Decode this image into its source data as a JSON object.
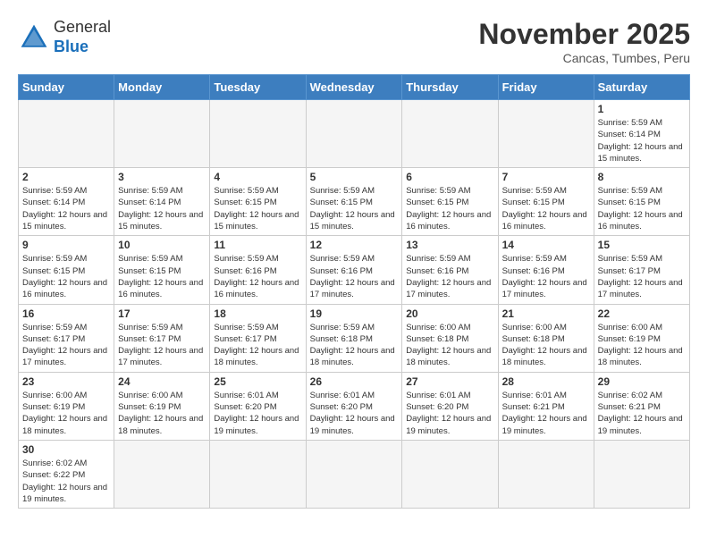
{
  "header": {
    "logo_text_general": "General",
    "logo_text_blue": "Blue",
    "month_year": "November 2025",
    "location": "Cancas, Tumbes, Peru"
  },
  "weekdays": [
    "Sunday",
    "Monday",
    "Tuesday",
    "Wednesday",
    "Thursday",
    "Friday",
    "Saturday"
  ],
  "weeks": [
    [
      {
        "day": "",
        "info": ""
      },
      {
        "day": "",
        "info": ""
      },
      {
        "day": "",
        "info": ""
      },
      {
        "day": "",
        "info": ""
      },
      {
        "day": "",
        "info": ""
      },
      {
        "day": "",
        "info": ""
      },
      {
        "day": "1",
        "info": "Sunrise: 5:59 AM\nSunset: 6:14 PM\nDaylight: 12 hours and 15 minutes."
      }
    ],
    [
      {
        "day": "2",
        "info": "Sunrise: 5:59 AM\nSunset: 6:14 PM\nDaylight: 12 hours and 15 minutes."
      },
      {
        "day": "3",
        "info": "Sunrise: 5:59 AM\nSunset: 6:14 PM\nDaylight: 12 hours and 15 minutes."
      },
      {
        "day": "4",
        "info": "Sunrise: 5:59 AM\nSunset: 6:15 PM\nDaylight: 12 hours and 15 minutes."
      },
      {
        "day": "5",
        "info": "Sunrise: 5:59 AM\nSunset: 6:15 PM\nDaylight: 12 hours and 15 minutes."
      },
      {
        "day": "6",
        "info": "Sunrise: 5:59 AM\nSunset: 6:15 PM\nDaylight: 12 hours and 16 minutes."
      },
      {
        "day": "7",
        "info": "Sunrise: 5:59 AM\nSunset: 6:15 PM\nDaylight: 12 hours and 16 minutes."
      },
      {
        "day": "8",
        "info": "Sunrise: 5:59 AM\nSunset: 6:15 PM\nDaylight: 12 hours and 16 minutes."
      }
    ],
    [
      {
        "day": "9",
        "info": "Sunrise: 5:59 AM\nSunset: 6:15 PM\nDaylight: 12 hours and 16 minutes."
      },
      {
        "day": "10",
        "info": "Sunrise: 5:59 AM\nSunset: 6:15 PM\nDaylight: 12 hours and 16 minutes."
      },
      {
        "day": "11",
        "info": "Sunrise: 5:59 AM\nSunset: 6:16 PM\nDaylight: 12 hours and 16 minutes."
      },
      {
        "day": "12",
        "info": "Sunrise: 5:59 AM\nSunset: 6:16 PM\nDaylight: 12 hours and 17 minutes."
      },
      {
        "day": "13",
        "info": "Sunrise: 5:59 AM\nSunset: 6:16 PM\nDaylight: 12 hours and 17 minutes."
      },
      {
        "day": "14",
        "info": "Sunrise: 5:59 AM\nSunset: 6:16 PM\nDaylight: 12 hours and 17 minutes."
      },
      {
        "day": "15",
        "info": "Sunrise: 5:59 AM\nSunset: 6:17 PM\nDaylight: 12 hours and 17 minutes."
      }
    ],
    [
      {
        "day": "16",
        "info": "Sunrise: 5:59 AM\nSunset: 6:17 PM\nDaylight: 12 hours and 17 minutes."
      },
      {
        "day": "17",
        "info": "Sunrise: 5:59 AM\nSunset: 6:17 PM\nDaylight: 12 hours and 17 minutes."
      },
      {
        "day": "18",
        "info": "Sunrise: 5:59 AM\nSunset: 6:17 PM\nDaylight: 12 hours and 18 minutes."
      },
      {
        "day": "19",
        "info": "Sunrise: 5:59 AM\nSunset: 6:18 PM\nDaylight: 12 hours and 18 minutes."
      },
      {
        "day": "20",
        "info": "Sunrise: 6:00 AM\nSunset: 6:18 PM\nDaylight: 12 hours and 18 minutes."
      },
      {
        "day": "21",
        "info": "Sunrise: 6:00 AM\nSunset: 6:18 PM\nDaylight: 12 hours and 18 minutes."
      },
      {
        "day": "22",
        "info": "Sunrise: 6:00 AM\nSunset: 6:19 PM\nDaylight: 12 hours and 18 minutes."
      }
    ],
    [
      {
        "day": "23",
        "info": "Sunrise: 6:00 AM\nSunset: 6:19 PM\nDaylight: 12 hours and 18 minutes."
      },
      {
        "day": "24",
        "info": "Sunrise: 6:00 AM\nSunset: 6:19 PM\nDaylight: 12 hours and 18 minutes."
      },
      {
        "day": "25",
        "info": "Sunrise: 6:01 AM\nSunset: 6:20 PM\nDaylight: 12 hours and 19 minutes."
      },
      {
        "day": "26",
        "info": "Sunrise: 6:01 AM\nSunset: 6:20 PM\nDaylight: 12 hours and 19 minutes."
      },
      {
        "day": "27",
        "info": "Sunrise: 6:01 AM\nSunset: 6:20 PM\nDaylight: 12 hours and 19 minutes."
      },
      {
        "day": "28",
        "info": "Sunrise: 6:01 AM\nSunset: 6:21 PM\nDaylight: 12 hours and 19 minutes."
      },
      {
        "day": "29",
        "info": "Sunrise: 6:02 AM\nSunset: 6:21 PM\nDaylight: 12 hours and 19 minutes."
      }
    ],
    [
      {
        "day": "30",
        "info": "Sunrise: 6:02 AM\nSunset: 6:22 PM\nDaylight: 12 hours and 19 minutes."
      },
      {
        "day": "",
        "info": ""
      },
      {
        "day": "",
        "info": ""
      },
      {
        "day": "",
        "info": ""
      },
      {
        "day": "",
        "info": ""
      },
      {
        "day": "",
        "info": ""
      },
      {
        "day": "",
        "info": ""
      }
    ]
  ]
}
